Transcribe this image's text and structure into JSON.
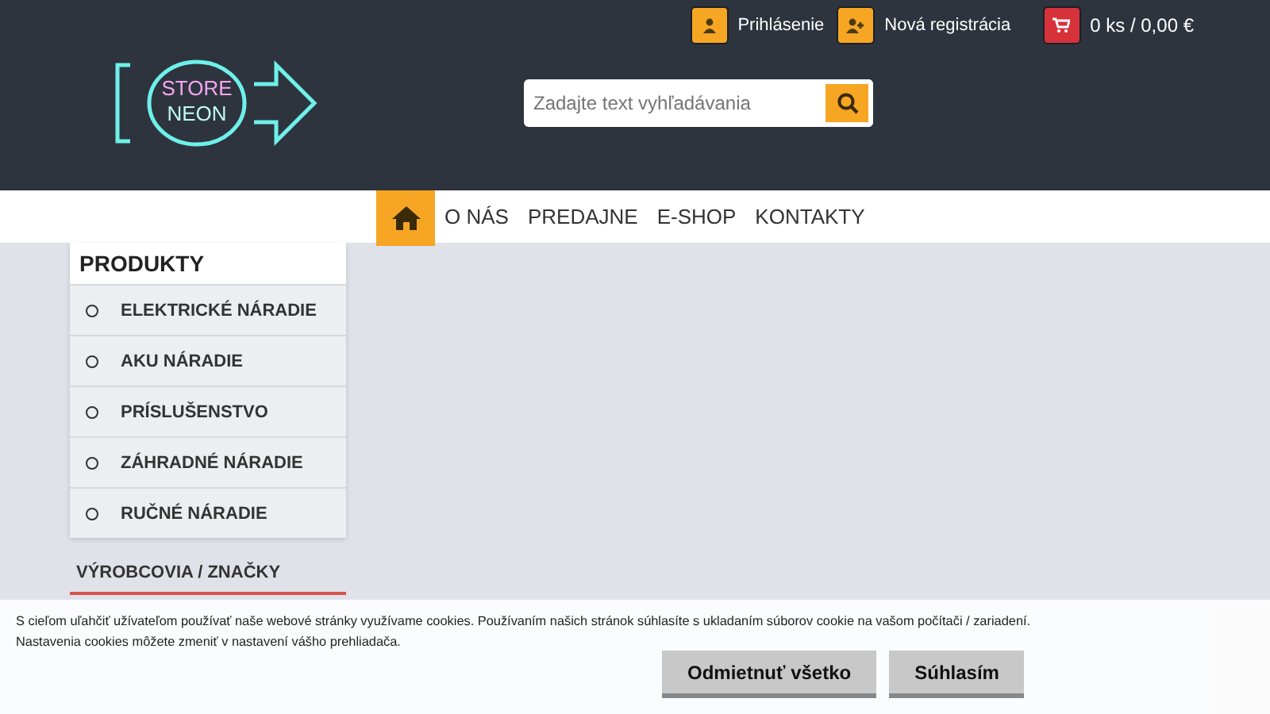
{
  "top_links": [
    {
      "kind": "user",
      "label": "Prihlásenie"
    },
    {
      "kind": "register",
      "label": "Nová registrácia"
    }
  ],
  "cart": {
    "label": "0 ks / 0,00 €"
  },
  "logo": {
    "line1": "STORE",
    "line2": "NEON"
  },
  "search": {
    "placeholder": "Zadajte text vyhľadávania"
  },
  "nav": [
    {
      "label": "O NÁS"
    },
    {
      "label": "PREDAJNE"
    },
    {
      "label": "E-SHOP"
    },
    {
      "label": "KONTAKTY"
    }
  ],
  "sidebar": {
    "title": "PRODUKTY",
    "items": [
      "ELEKTRICKÉ NÁRADIE",
      "AKU NÁRADIE",
      "PRÍSLUŠENSTVO",
      "ZÁHRADNÉ NÁRADIE",
      "RUČNÉ NÁRADIE"
    ]
  },
  "brands": {
    "title": "VÝROBCOVIA / ZNAČKY"
  },
  "cookie": {
    "text": "S cieľom uľahčiť užívateľom používať naše webové stránky využívame cookies. Používaním našich stránok súhlasíte s ukladaním súborov cookie na vašom počítači / zariadení.",
    "text2": "Nastavenia cookies môžete zmeniť v nastavení vášho prehliadača.",
    "buttons": [
      "Odmietnuť všetko",
      "Súhlasím"
    ]
  }
}
